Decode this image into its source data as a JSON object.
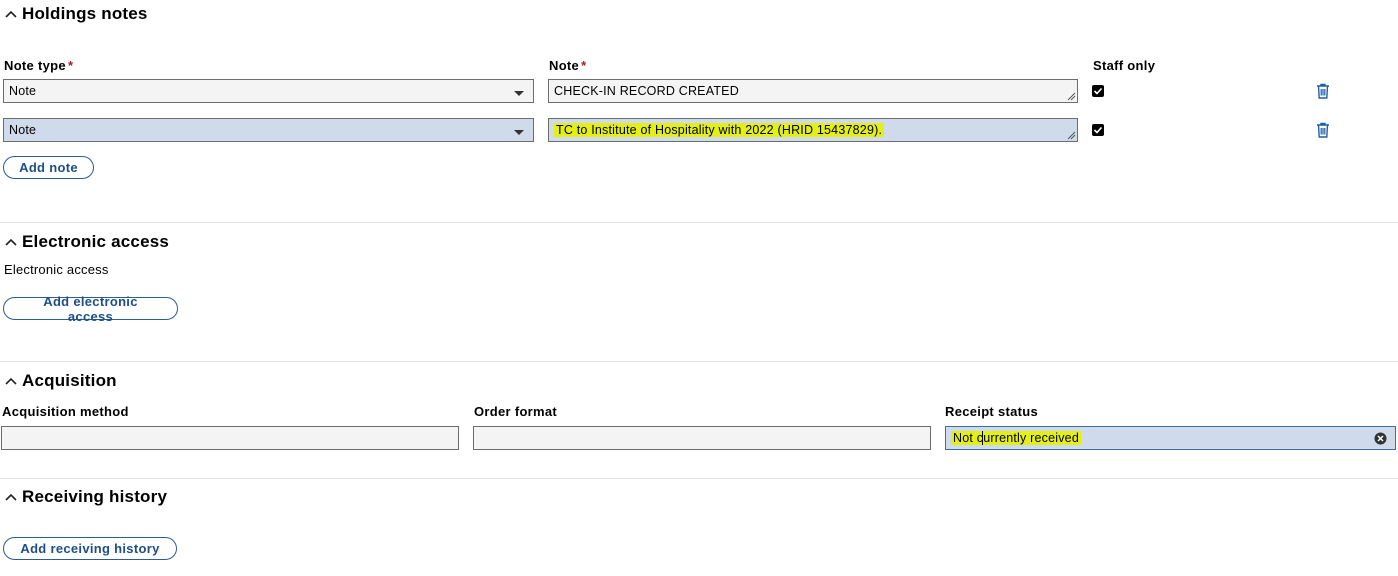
{
  "holdings_notes": {
    "title": "Holdings notes",
    "note_type_label": "Note type",
    "note_label": "Note",
    "staff_only_label": "Staff only",
    "required_mark": "*",
    "rows": [
      {
        "note_type": "Note",
        "note": "CHECK-IN RECORD CREATED",
        "staff_only": true
      },
      {
        "note_type": "Note",
        "note": "TC to Institute of Hospitality with 2022 (HRID 15437829).",
        "staff_only": true
      }
    ],
    "add_button": "Add note"
  },
  "electronic_access": {
    "title": "Electronic access",
    "empty_text": "Electronic access",
    "add_button": "Add electronic access"
  },
  "acquisition": {
    "title": "Acquisition",
    "method_label": "Acquisition method",
    "method_value": "",
    "order_format_label": "Order format",
    "order_format_value": "",
    "receipt_status_label": "Receipt status",
    "receipt_status_value_a": "Not c",
    "receipt_status_value_b": "urrently received"
  },
  "receiving_history": {
    "title": "Receiving history",
    "add_button": "Add receiving history"
  },
  "colors": {
    "accent": "#1d4f86",
    "highlight": "#e4ef1a",
    "selected_field": "#cfdbeb",
    "required": "#b01c1c"
  }
}
